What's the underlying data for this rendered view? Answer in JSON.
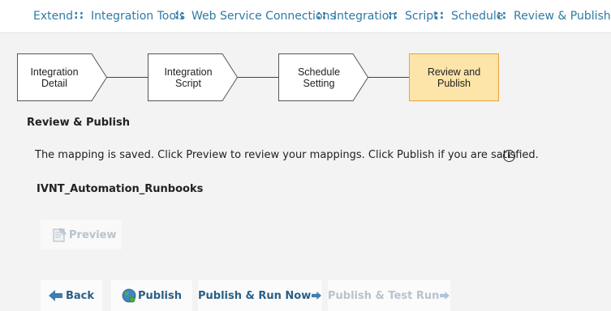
{
  "breadcrumb": {
    "items": [
      "Extend",
      "Integration Tools",
      "Web Service Connections",
      "Integration",
      "Script",
      "Schedule",
      "Review & Publish"
    ],
    "separator": "::"
  },
  "wizard": {
    "steps": [
      {
        "line1": "Integration",
        "line2": "Detail"
      },
      {
        "line1": "Integration",
        "line2": "Script"
      },
      {
        "line1": "Schedule",
        "line2": "Setting"
      },
      {
        "line1": "Review and",
        "line2": "Publish",
        "active": true
      }
    ]
  },
  "section_title": "Review & Publish",
  "message": "The mapping is saved. Click Preview to review your mappings. Click Publish if you are satisfied.",
  "runbook_name": "IVNT_Automation_Runbooks",
  "buttons": {
    "preview": "Preview",
    "back": "Back",
    "publish": "Publish",
    "publish_run_now": "Publish & Run Now",
    "publish_test_run": "Publish & Test Run"
  },
  "colors": {
    "link": "#2e7aa5",
    "button_text": "#2a5f86",
    "disabled_text": "#b9c3cc",
    "active_step_fill": "#fde4a8",
    "active_step_border": "#e8a33b"
  },
  "icons": {
    "info": "info-icon",
    "back": "arrow-left-icon",
    "publish": "globe-icon",
    "run_now": "arrow-right-icon",
    "preview": "preview-icon"
  }
}
